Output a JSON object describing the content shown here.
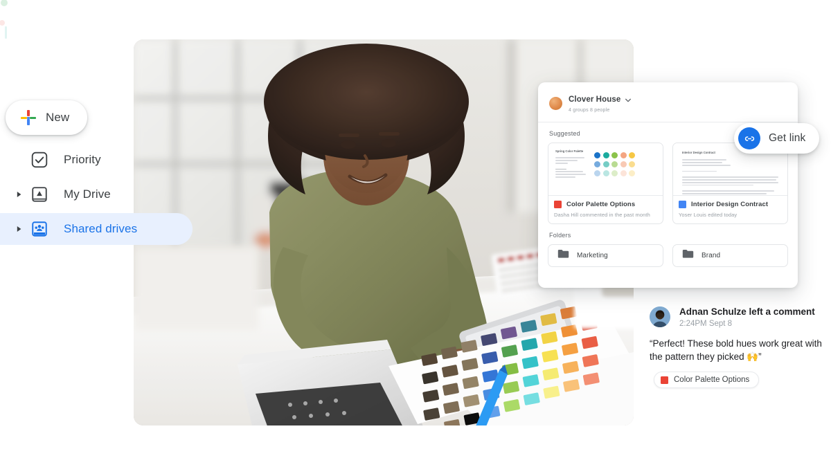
{
  "sidebar": {
    "new_button": {
      "label": "New",
      "icon": "google-plus-icon"
    },
    "items": [
      {
        "label": "Priority",
        "icon": "priority-check-icon",
        "has_caret": false,
        "selected": false
      },
      {
        "label": "My Drive",
        "icon": "my-drive-icon",
        "has_caret": true,
        "selected": false
      },
      {
        "label": "Shared drives",
        "icon": "shared-drives-icon",
        "has_caret": true,
        "selected": true
      }
    ]
  },
  "hero_photo": {
    "alt": "Designer leaning over a desk with a laptop, tablet and color swatch sheets"
  },
  "drive_card": {
    "title": "Clover House",
    "subtitle": "4 groups  8 people",
    "caret_icon": "chevron-down-icon",
    "suggested_label": "Suggested",
    "suggested": [
      {
        "name": "Color Palette Options",
        "meta": "Dasha Hill commented in the past month",
        "type": "pdf",
        "thumb": {
          "kind": "palette",
          "title": "Spring Color Palette",
          "colors": [
            "#1a73c8",
            "#1bab9e",
            "#8bc34a",
            "#f4a582",
            "#f6c744"
          ]
        }
      },
      {
        "name": "Interior Design Contract",
        "meta": "Yoser Louis edited today",
        "type": "doc",
        "thumb": {
          "kind": "document",
          "title": "Interior Design Contract"
        }
      }
    ],
    "folders_label": "Folders",
    "folders": [
      {
        "name": "Marketing",
        "icon": "folder-icon"
      },
      {
        "name": "Brand",
        "icon": "folder-icon"
      }
    ]
  },
  "get_link": {
    "label": "Get link",
    "icon": "link-icon",
    "accent": "#1a73e8"
  },
  "comment": {
    "author_line": "Adnan Schulze left a comment",
    "timestamp": "2:24PM Sept 8",
    "text": "“Perfect! These bold hues work great with the pattern they picked 🙌”",
    "chip": {
      "label": "Color Palette Options",
      "icon": "pdf-icon"
    },
    "avatar_icon": "user-avatar"
  },
  "theme": {
    "blue": "#1a73e8",
    "selected_bg": "#e8f0fe",
    "text": "#3c4043",
    "muted": "#9aa0a6"
  }
}
